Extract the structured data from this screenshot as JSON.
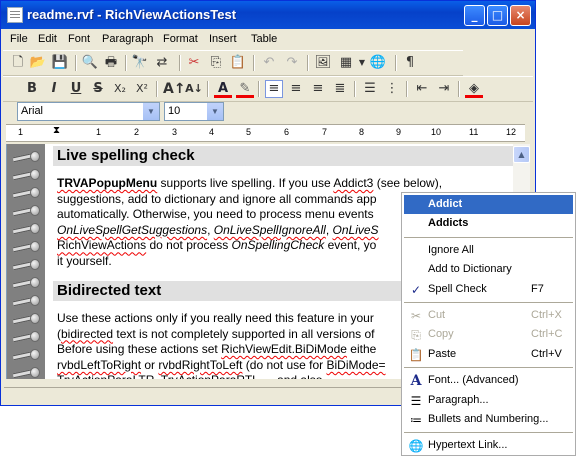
{
  "window": {
    "title": "readme.rvf - RichViewActionsTest"
  },
  "menu": [
    "File",
    "Edit",
    "Font",
    "Paragraph",
    "Format",
    "Insert",
    "Table"
  ],
  "format_bar": {
    "font_name": "Arial",
    "font_size": "10"
  },
  "ruler": {
    "marks": [
      "1",
      "1",
      "2",
      "3",
      "4",
      "5",
      "6",
      "7",
      "8",
      "9",
      "10",
      "11",
      "12"
    ]
  },
  "doc": {
    "heading1": "Live spelling check",
    "para1": [
      {
        "parts": [
          {
            "t": "TRVAPopupMenu",
            "b": 1,
            "u": 1
          },
          " supports live spelling. If you use ",
          {
            "t": "Addict3",
            "u": 1
          },
          " (see below),"
        ]
      },
      {
        "parts": [
          "suggestions, add to dictionary and ignore all commands app"
        ]
      },
      {
        "parts": [
          "automatically. Otherwise, you need to process menu events"
        ]
      },
      {
        "parts": [
          {
            "t": "OnLiveSpellGetSuggestions",
            "i": 1,
            "u": 1
          },
          ", ",
          {
            "t": "OnLiveSpellIgnoreAll",
            "i": 1,
            "u": 1
          },
          ", ",
          {
            "t": "OnLiveS",
            "i": 1,
            "u": 1
          }
        ]
      },
      {
        "parts": [
          {
            "t": "RichViewActions",
            "u": 1
          },
          " do not process ",
          {
            "t": "OnSpellingCheck",
            "i": 1
          },
          " event, yo"
        ]
      },
      {
        "parts": [
          "it yourself."
        ]
      }
    ],
    "heading2": "Bidirected text",
    "para2": [
      {
        "parts": [
          "Use these actions only if you really need this feature in your"
        ]
      },
      {
        "parts": [
          "(",
          {
            "t": "bidirected",
            "u": 1
          },
          " text is not completely supported in all versions of"
        ]
      },
      {
        "parts": [
          "Before using these actions set ",
          {
            "t": "RichViewEdit.BiDiMode",
            "u": 1
          },
          " eithe"
        ]
      },
      {
        "parts": [
          {
            "t": "rvbdLeftToRight",
            "u": 1
          },
          " or ",
          {
            "t": "rvbdRightToLeft",
            "u": 1
          },
          " (do not use for ",
          {
            "t": "BiDiMode=",
            "u": 1
          }
        ]
      },
      {
        "parts": [
          {
            "t": "TrvActionParaLTR, TrvActionParaRTL",
            "u": 1
          },
          " — and also"
        ]
      }
    ]
  },
  "context_menu": [
    {
      "label": "Addict",
      "bold": true,
      "highlight": true
    },
    {
      "label": "Addicts",
      "bold": true
    },
    {
      "sep": true
    },
    {
      "label": "Ignore All"
    },
    {
      "label": "Add to Dictionary"
    },
    {
      "label": "Spell Check",
      "shortcut": "F7",
      "icon": "spell-check-icon"
    },
    {
      "sep": true
    },
    {
      "label": "Cut",
      "shortcut": "Ctrl+X",
      "disabled": true,
      "icon": "scissors-icon"
    },
    {
      "label": "Copy",
      "shortcut": "Ctrl+C",
      "disabled": true,
      "icon": "copy-icon"
    },
    {
      "label": "Paste",
      "shortcut": "Ctrl+V",
      "icon": "paste-icon"
    },
    {
      "sep": true
    },
    {
      "label": "Font... (Advanced)",
      "icon": "font-icon"
    },
    {
      "label": "Paragraph...",
      "icon": "paragraph-icon"
    },
    {
      "label": "Bullets and Numbering...",
      "icon": "bullets-icon"
    },
    {
      "sep": true
    },
    {
      "label": "Hypertext Link...",
      "icon": "globe-link-icon"
    }
  ]
}
